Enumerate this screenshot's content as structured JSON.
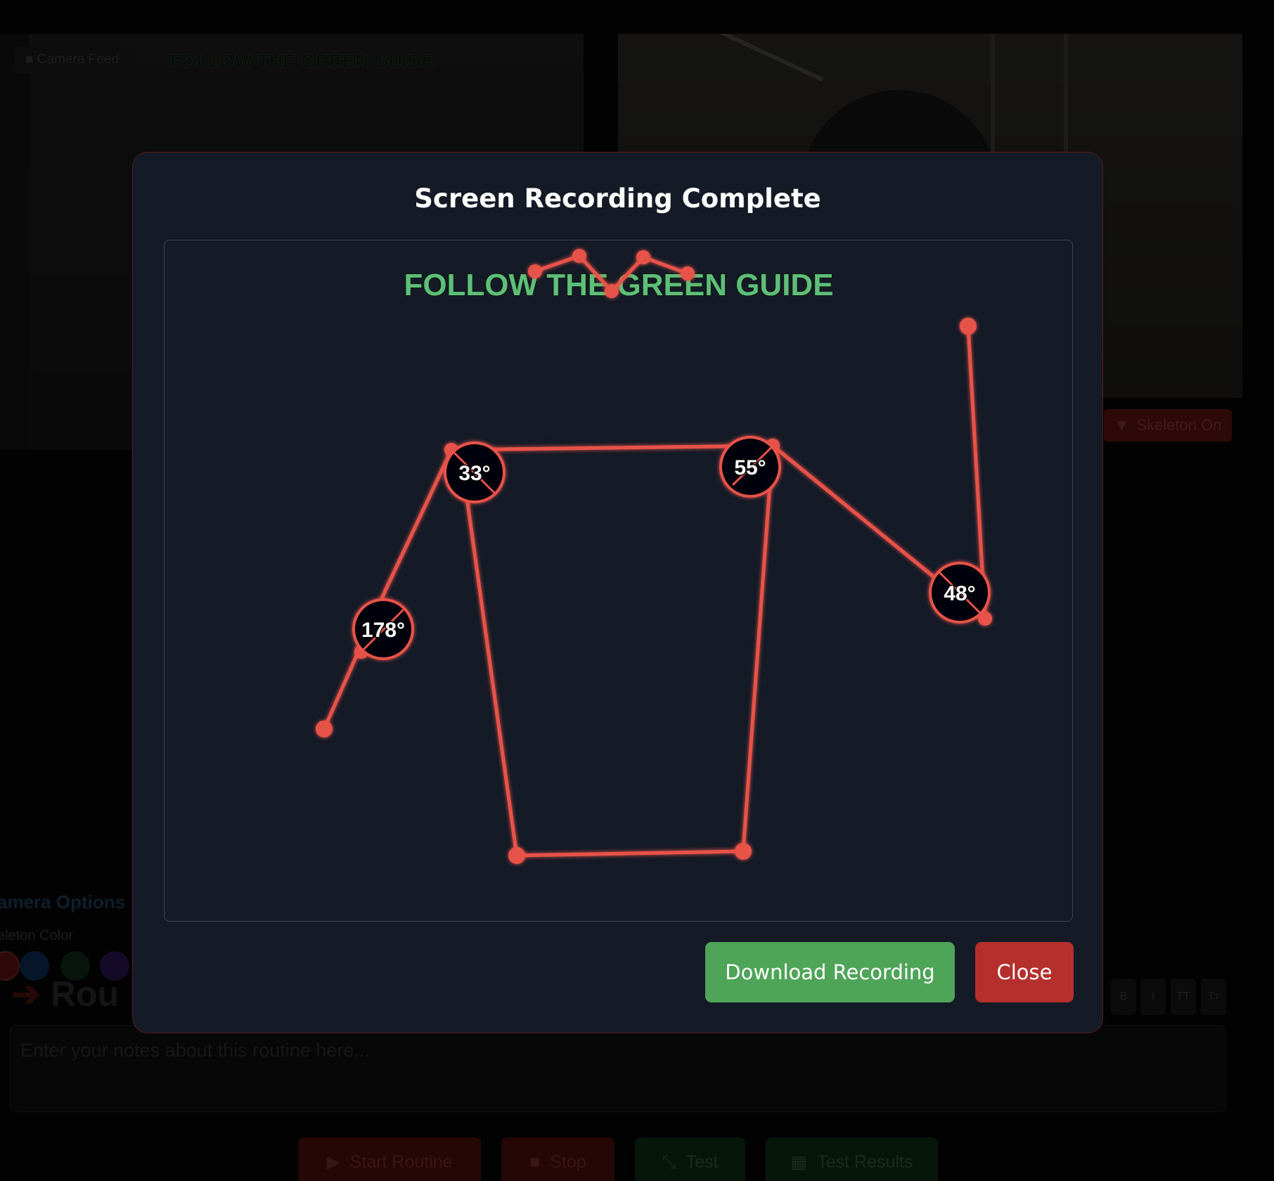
{
  "background": {
    "camera_feed_label": "Camera Feed",
    "guide_text_small": "FOLLOW THE GREEN GUIDE",
    "skeleton_toggle_label": "Skeleton On",
    "camera_options_heading": "amera Options",
    "skeleton_color_label": "eleton Color",
    "swatches": [
      "#5a1512",
      "#0f2a55",
      "#0e2a1a",
      "#2a1650"
    ],
    "routine_title": "Rou",
    "format_buttons": [
      "B",
      "I",
      "TT",
      "Tт"
    ],
    "notes_placeholder": "Enter your notes about this routine here...",
    "buttons": {
      "start": "Start Routine",
      "stop": "Stop",
      "test": "Test",
      "test_results": "Test Results"
    }
  },
  "modal": {
    "title": "Screen Recording Complete",
    "preview": {
      "guide_text": "FOLLOW THE GREEN GUIDE",
      "skeleton_color": "#e8524a",
      "angles": [
        "33°",
        "55°",
        "178°",
        "48°"
      ]
    },
    "download_label": "Download Recording",
    "close_label": "Close"
  }
}
